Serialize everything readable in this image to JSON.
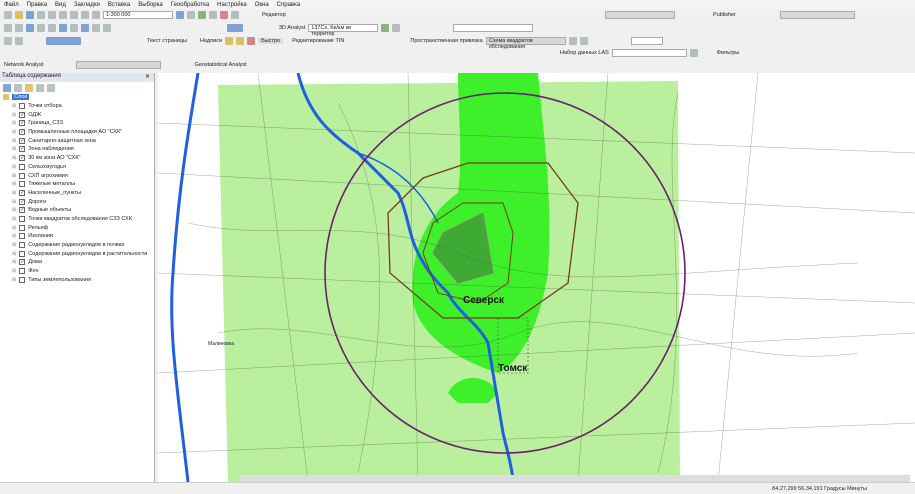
{
  "menu": [
    "Файл",
    "Правка",
    "Вид",
    "Закладки",
    "Вставка",
    "Выборка",
    "Геообработка",
    "Настройка",
    "Окна",
    "Справка"
  ],
  "toolbar": {
    "scale": "1:300 000",
    "editor": "Редактор",
    "analyst3d": "3D Analyst",
    "layer3d": "137Cs, Ки/км кв территор",
    "publisher": "Publisher",
    "page_text": "Текст страницы",
    "labels": "Надписи",
    "fast": "Быстро",
    "tin_edit": "Редактирование TIN",
    "spatial_adjust": "Пространственная привязка",
    "spatial_layer": "Схема квадратов обследования",
    "las_dataset": "Набор данных LAS",
    "filters": "Фильтры",
    "network_analyst": "Network Analyst",
    "geostat": "Geostatistical Analyst"
  },
  "toc": {
    "title": "Таблица содержания",
    "root": "Слои",
    "layers": [
      {
        "name": "Точки отбора",
        "checked": false
      },
      {
        "name": "ОДЖ",
        "checked": true
      },
      {
        "name": "Граница_СЗЗ",
        "checked": true
      },
      {
        "name": "Промышленные площадки АО \"СХК\"",
        "checked": true
      },
      {
        "name": "Санитарно-защитная зона",
        "checked": true
      },
      {
        "name": "Зона наблюдения",
        "checked": true
      },
      {
        "name": "30 км зона АО \"СХК\"",
        "checked": true
      },
      {
        "name": "Сельхозугодья",
        "checked": false
      },
      {
        "name": "СХП агрохимия",
        "checked": false
      },
      {
        "name": "Тяжелые металлы",
        "checked": false
      },
      {
        "name": "Населенные_пункты",
        "checked": true
      },
      {
        "name": "Дороги",
        "checked": true
      },
      {
        "name": "Водные объекты",
        "checked": true
      },
      {
        "name": "Точки квадратов обследования СЗЗ СХК",
        "checked": false
      },
      {
        "name": "Рельеф",
        "checked": false
      },
      {
        "name": "Изолинии",
        "checked": false
      },
      {
        "name": "Содержание радионуклидов в почвах",
        "checked": false
      },
      {
        "name": "Содержание радионуклидов в растительности",
        "checked": false
      },
      {
        "name": "Дома",
        "checked": true
      },
      {
        "name": "Фон",
        "checked": false
      },
      {
        "name": "Типы землепользования",
        "checked": false
      }
    ]
  },
  "map": {
    "city1": "Северск",
    "city2": "Томск",
    "village": "Малиновка"
  },
  "status": {
    "coords": "84,27,299  56,34,191  Градусы Минуты"
  },
  "colors": {
    "green_light": "#b9ef9d",
    "green_bright": "#3ef02a",
    "circle": "#6a1f6f",
    "buffer": "#7a3a1a",
    "river": "#1f5fe0"
  }
}
